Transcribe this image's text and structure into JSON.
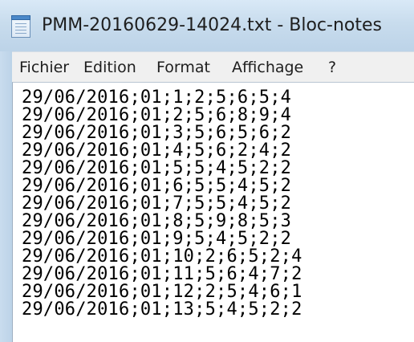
{
  "window": {
    "title": "PMM-20160629-14024.txt - Bloc-notes",
    "app_icon": "notepad-icon"
  },
  "menu": {
    "items": [
      "Fichier",
      "Edition",
      "Format",
      "Affichage",
      "?"
    ]
  },
  "editor": {
    "lines": [
      "29/06/2016;01;1;2;5;6;5;4",
      "29/06/2016;01;2;5;6;8;9;4",
      "29/06/2016;01;3;5;6;5;6;2",
      "29/06/2016;01;4;5;6;2;4;2",
      "29/06/2016;01;5;5;4;5;2;2",
      "29/06/2016;01;6;5;5;4;5;2",
      "29/06/2016;01;7;5;5;4;5;2",
      "29/06/2016;01;8;5;9;8;5;3",
      "29/06/2016;01;9;5;4;5;2;2",
      "29/06/2016;01;10;2;6;5;2;4",
      "29/06/2016;01;11;5;6;4;7;2",
      "29/06/2016;01;12;2;5;4;6;1",
      "29/06/2016;01;13;5;4;5;2;2"
    ]
  }
}
